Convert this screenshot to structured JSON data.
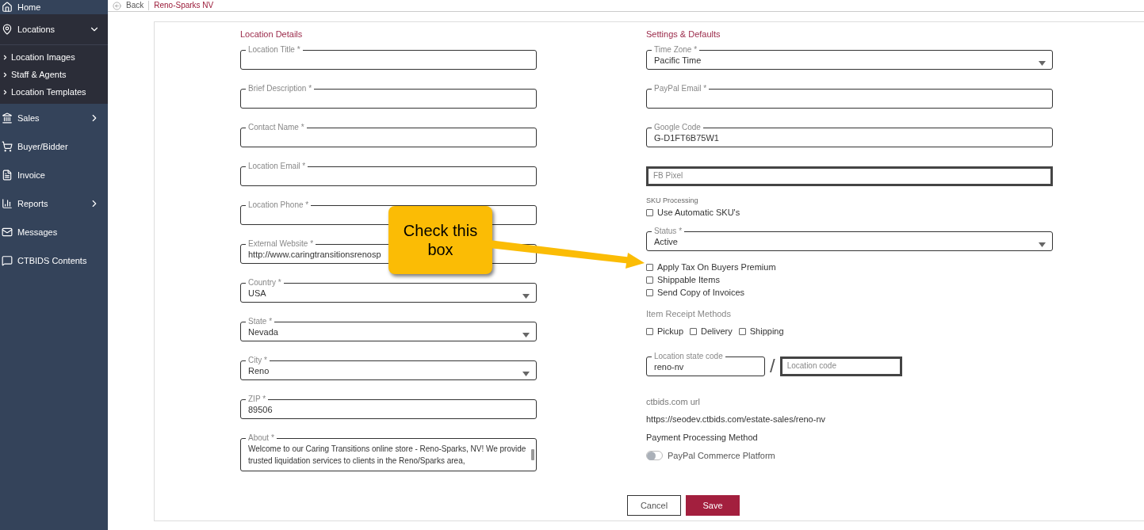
{
  "sidebar": {
    "items": [
      {
        "label": "Home"
      },
      {
        "label": "Locations",
        "expanded": true,
        "children": [
          {
            "label": "Location Images"
          },
          {
            "label": "Staff & Agents"
          },
          {
            "label": "Location Templates"
          }
        ]
      },
      {
        "label": "Sales",
        "expanded": false
      },
      {
        "label": "Buyer/Bidder"
      },
      {
        "label": "Invoice"
      },
      {
        "label": "Reports",
        "expanded": false
      },
      {
        "label": "Messages"
      },
      {
        "label": "CTBIDS Contents"
      }
    ]
  },
  "topbar": {
    "back": "Back",
    "breadcrumb": "Reno-Sparks NV"
  },
  "location_details": {
    "title": "Location Details",
    "fields": [
      {
        "kind": "text",
        "label": "Location Title *"
      },
      {
        "kind": "text",
        "label": "Brief Description *"
      },
      {
        "kind": "text",
        "label": "Contact Name *"
      },
      {
        "kind": "text",
        "label": "Location Email *"
      },
      {
        "kind": "text",
        "label": "Location Phone *"
      },
      {
        "kind": "text",
        "label": "External Website *",
        "value": "http://www.caringtransitionsrenosp"
      },
      {
        "kind": "select",
        "label": "Country *",
        "value": "USA"
      },
      {
        "kind": "select",
        "label": "State *",
        "value": "Nevada"
      },
      {
        "kind": "select",
        "label": "City *",
        "value": "Reno"
      },
      {
        "kind": "text",
        "label": "ZIP *",
        "value": "89506"
      },
      {
        "kind": "textarea",
        "label": "About *",
        "value": "Welcome to our Caring Transitions online store - Reno-Sparks, NV! We provide trusted liquidation services to clients in the Reno/Sparks area,"
      }
    ]
  },
  "settings": {
    "title": "Settings & Defaults",
    "fields": [
      {
        "kind": "select",
        "label": "Time Zone *",
        "value": "Pacific Time"
      },
      {
        "kind": "text",
        "label": "PayPal Email *"
      },
      {
        "kind": "text",
        "label": "Google Code",
        "value": "G-D1FT6B75W1"
      },
      {
        "kind": "text",
        "placeholder": "FB Pixel"
      }
    ],
    "sku_label": "SKU Processing",
    "sku_checkbox": {
      "label": "Use Automatic SKU's",
      "checked": false
    },
    "status": {
      "label": "Status *",
      "value": "Active"
    },
    "options": [
      {
        "label": "Apply Tax On Buyers Premium",
        "checked": false
      },
      {
        "label": "Shippable Items",
        "checked": false
      },
      {
        "label": "Send Copy of Invoices",
        "checked": false
      }
    ],
    "receipt_title": "Item Receipt Methods",
    "receipt_methods": [
      {
        "label": "Pickup",
        "checked": false
      },
      {
        "label": "Delivery",
        "checked": false
      },
      {
        "label": "Shipping",
        "checked": false
      }
    ],
    "state_code": {
      "label": "Location state code",
      "value": "reno-nv"
    },
    "separator": "/",
    "location_code": {
      "placeholder": "Location code"
    },
    "url_label": "ctbids.com url",
    "url": "https://seodev.ctbids.com/estate-sales/reno-nv",
    "payment_title": "Payment Processing Method",
    "payment_toggle": {
      "label": "PayPal Commerce Platform",
      "on": false
    }
  },
  "buttons": [
    {
      "kind": "secondary",
      "label": "Cancel"
    },
    {
      "kind": "primary",
      "label": "Save"
    }
  ],
  "callout": {
    "text": "Check this box"
  }
}
